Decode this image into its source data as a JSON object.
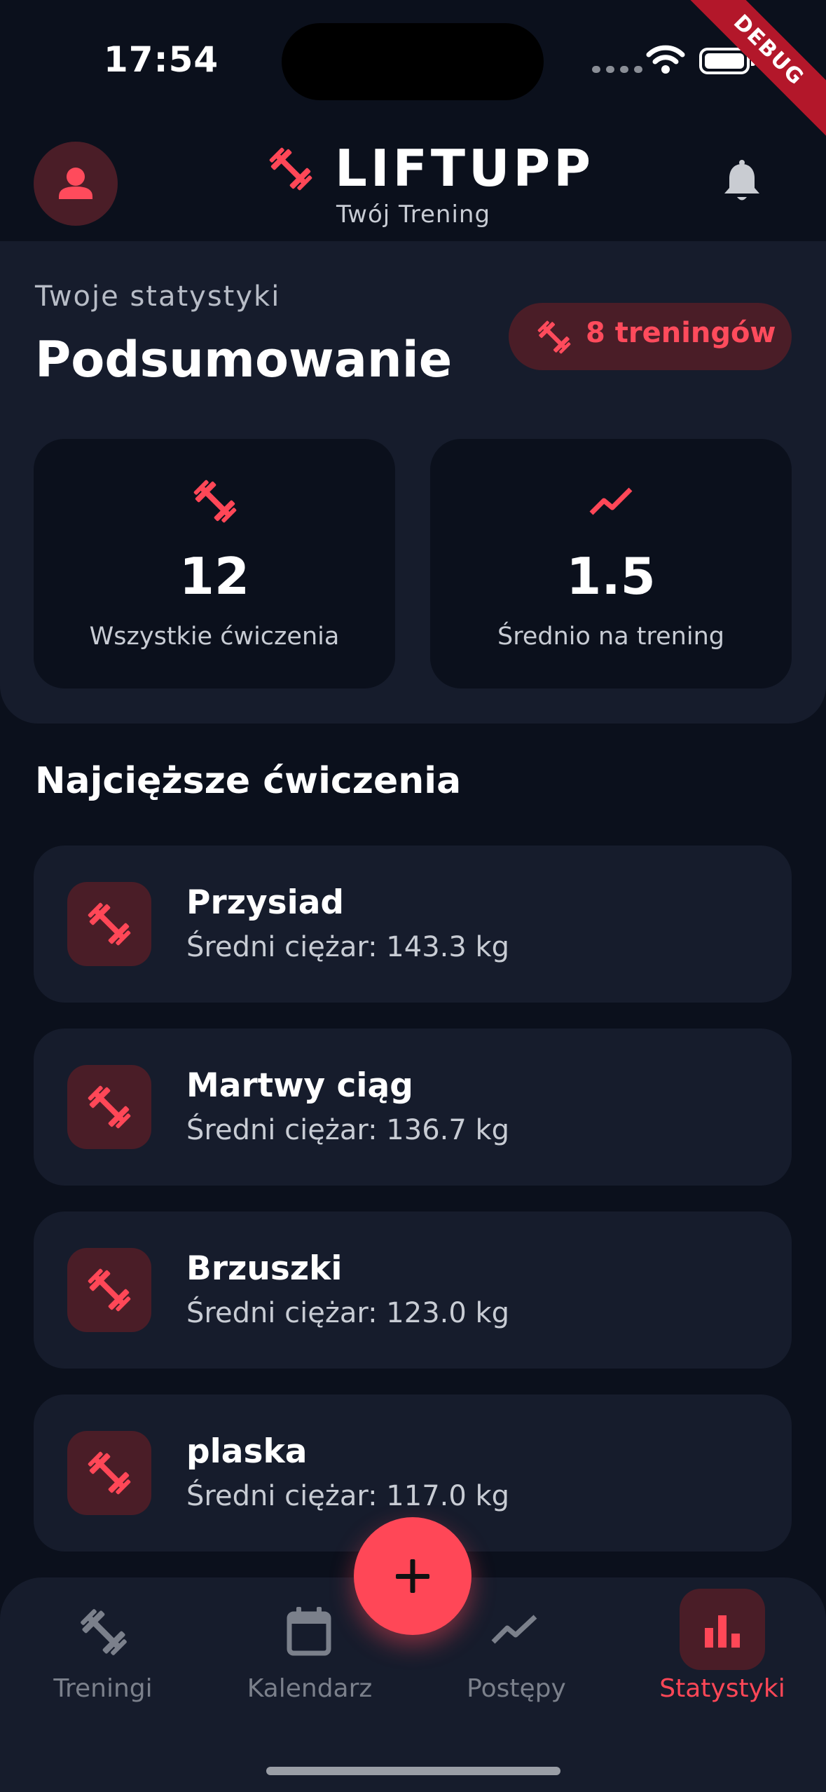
{
  "status_bar": {
    "time": "17:54",
    "debug_label": "DEBUG"
  },
  "header": {
    "title": "LIFTUPP",
    "subtitle": "Twój Trening"
  },
  "summary": {
    "label": "Twoje statystyki",
    "title": "Podsumowanie",
    "badge": "8 treningów",
    "stats": [
      {
        "value": "12",
        "label": "Wszystkie ćwiczenia",
        "icon": "dumbbell-icon"
      },
      {
        "value": "1.5",
        "label": "Średnio na trening",
        "icon": "trending-up-icon"
      }
    ]
  },
  "heaviest": {
    "title": "Najcięższe ćwiczenia",
    "items": [
      {
        "name": "Przysiad",
        "weight": "Średni ciężar: 143.3 kg"
      },
      {
        "name": "Martwy ciąg",
        "weight": "Średni ciężar: 136.7 kg"
      },
      {
        "name": "Brzuszki",
        "weight": "Średni ciężar: 123.0 kg"
      },
      {
        "name": "plaska",
        "weight": "Średni ciężar: 117.0 kg"
      }
    ]
  },
  "nav": {
    "items": [
      {
        "label": "Treningi",
        "icon": "dumbbell-icon"
      },
      {
        "label": "Kalendarz",
        "icon": "calendar-icon"
      },
      {
        "label": "Postępy",
        "icon": "trending-up-icon"
      },
      {
        "label": "Statystyki",
        "icon": "bar-chart-icon",
        "active": true
      }
    ]
  },
  "colors": {
    "accent": "#ff4757",
    "background": "#0b101c",
    "card": "#161c2c",
    "accent_tint": "#4a1d27"
  }
}
